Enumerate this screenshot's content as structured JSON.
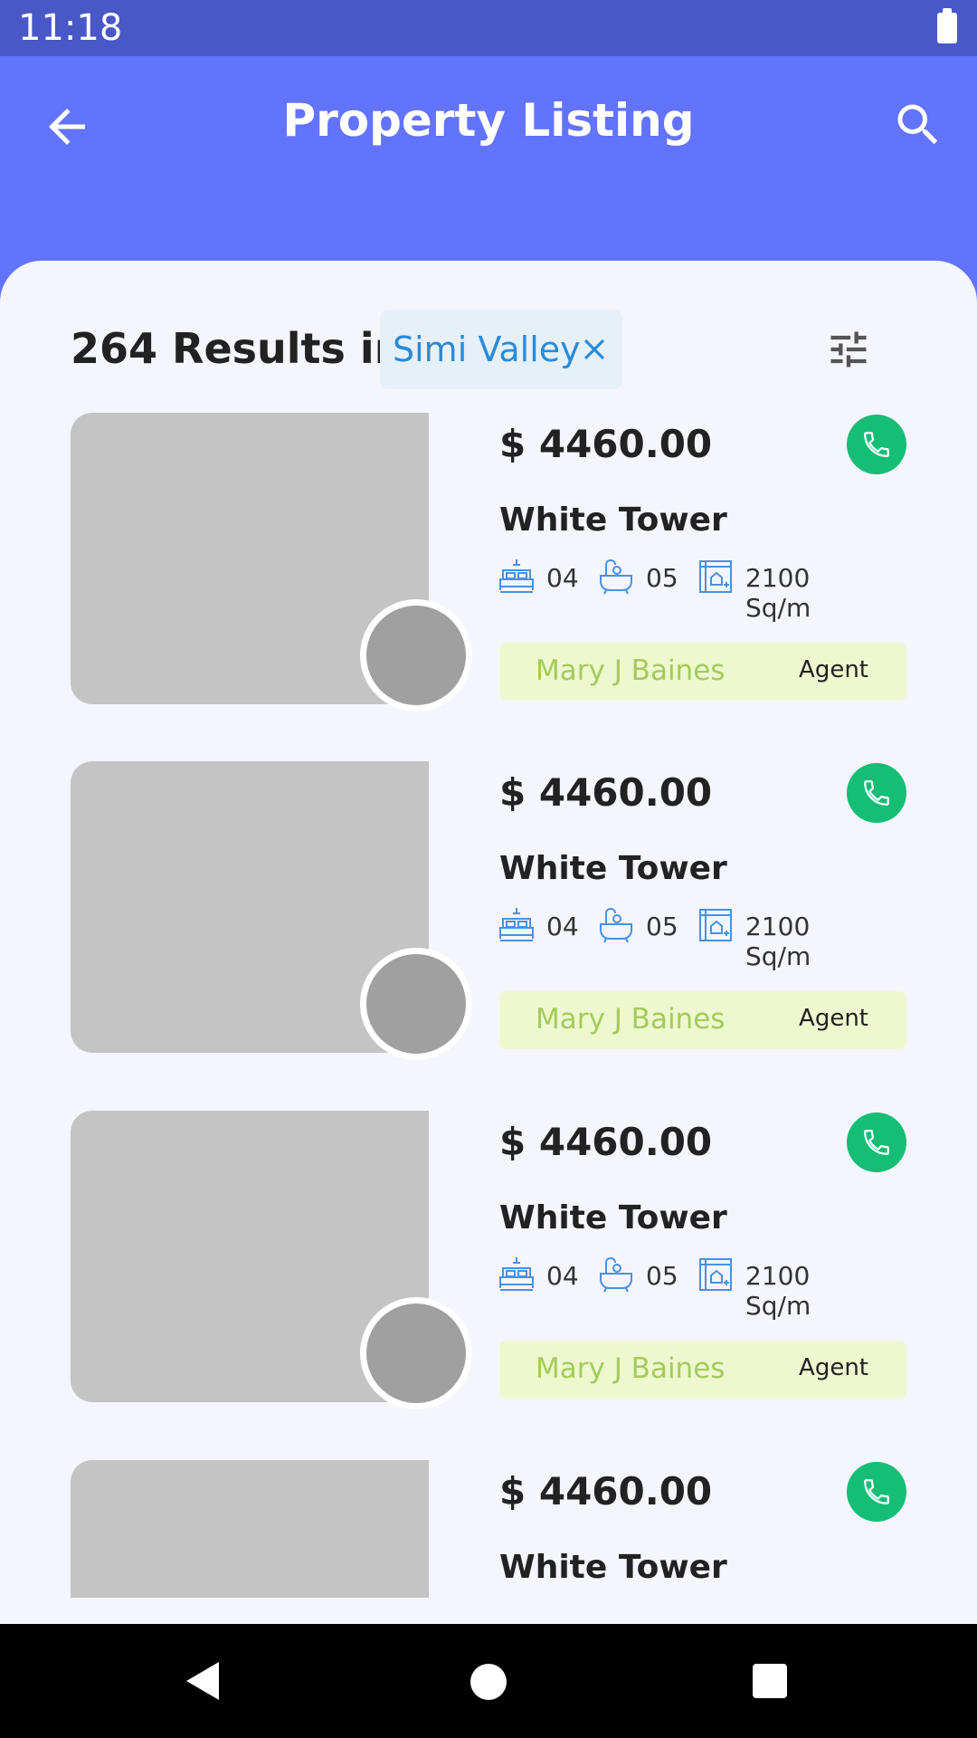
{
  "status_bar": {
    "time": "11:18",
    "battery_icon": "battery-full-icon"
  },
  "app_bar": {
    "title": "Property Listing",
    "back_icon": "arrow-back-icon",
    "search_icon": "search-icon"
  },
  "filters": {
    "results_label": "264 Results in",
    "location_chip": "Simi Valley",
    "chip_close_icon": "close-icon",
    "filter_icon": "tune-icon"
  },
  "listings": [
    {
      "price": "$ 4460.00",
      "name": "White Tower",
      "beds": "04",
      "baths": "05",
      "area": "2100 Sq/m",
      "agent_name": "Mary J Baines",
      "agent_role": "Agent"
    },
    {
      "price": "$ 4460.00",
      "name": "White Tower",
      "beds": "04",
      "baths": "05",
      "area": "2100 Sq/m",
      "agent_name": "Mary J Baines",
      "agent_role": "Agent"
    },
    {
      "price": "$ 4460.00",
      "name": "White Tower",
      "beds": "04",
      "baths": "05",
      "area": "2100 Sq/m",
      "agent_name": "Mary J Baines",
      "agent_role": "Agent"
    },
    {
      "price": "$ 4460.00",
      "name": "White Tower"
    }
  ],
  "colors": {
    "primary": "#6273FE",
    "status_bar": "#4A57C7",
    "call_green": "#15BD75",
    "agent_bg": "#EDF8CF",
    "agent_text": "#A4CB5B",
    "chip_text": "#2A8BD8"
  },
  "nav_bar": {
    "back_icon": "nav-back-icon",
    "home_icon": "nav-home-icon",
    "recents_icon": "nav-recents-icon"
  }
}
